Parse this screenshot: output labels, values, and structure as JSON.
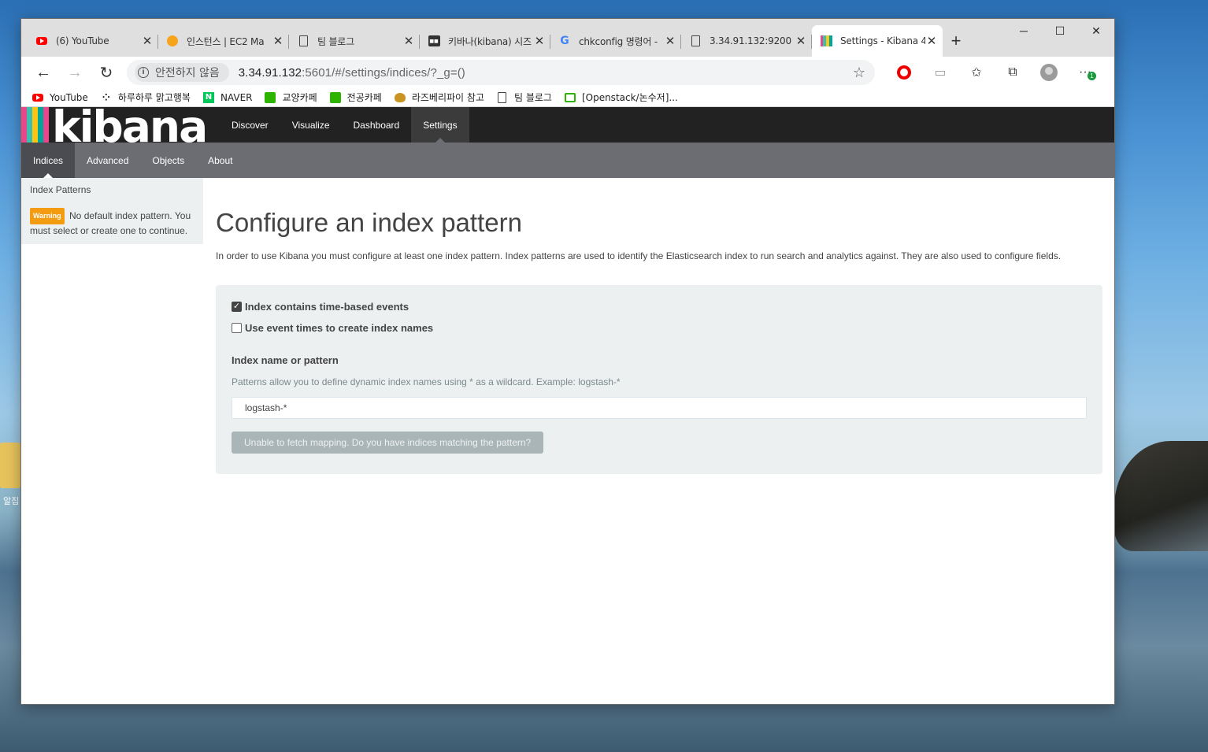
{
  "desktop": {
    "icon_label": "알집"
  },
  "browser": {
    "tabs": [
      {
        "title": "(6) YouTube",
        "icon": "youtube-icon",
        "active": false
      },
      {
        "title": "인스턴스 | EC2 Ma",
        "icon": "aws-icon",
        "active": false
      },
      {
        "title": "팀 블로그",
        "icon": "document-icon",
        "active": false
      },
      {
        "title": "키바나(kibana) 시즈",
        "icon": "blog-dark-icon",
        "active": false
      },
      {
        "title": "chkconfig 명령어 -",
        "icon": "google-icon",
        "active": false
      },
      {
        "title": "3.34.91.132:9200",
        "icon": "document-icon",
        "active": false
      },
      {
        "title": "Settings - Kibana 4",
        "icon": "kibana-icon",
        "active": true
      }
    ],
    "security_label": "안전하지 않음",
    "url_host": "3.34.91.132",
    "url_rest": ":5601/#/settings/indices/?_g=()",
    "extension_badge": "1",
    "bookmarks": [
      {
        "label": "YouTube",
        "icon": "youtube-icon"
      },
      {
        "label": "하루하루 맑고행복",
        "icon": "dots-icon"
      },
      {
        "label": "NAVER",
        "icon": "naver-icon"
      },
      {
        "label": "교양카페",
        "icon": "cafe-icon"
      },
      {
        "label": "전공카페",
        "icon": "cafe-icon"
      },
      {
        "label": "라즈베리파이 참고",
        "icon": "raspberry-icon"
      },
      {
        "label": "팀 블로그",
        "icon": "document-icon"
      },
      {
        "label": "[Openstack/논수저]...",
        "icon": "blog-icon"
      }
    ]
  },
  "kibana": {
    "logo": "kibana",
    "logo_colors": [
      "#e8488b",
      "#3cbeb1",
      "#fec514",
      "#00a69b",
      "#e8488b"
    ],
    "nav": [
      "Discover",
      "Visualize",
      "Dashboard",
      "Settings"
    ],
    "active_nav": "Settings",
    "subnav": [
      "Indices",
      "Advanced",
      "Objects",
      "About"
    ],
    "active_subnav": "Indices",
    "sidebar": {
      "title": "Index Patterns",
      "warning_badge": "Warning",
      "warning_text": "No default index pattern. You must select or create one to continue."
    },
    "main": {
      "title": "Configure an index pattern",
      "intro": "In order to use Kibana you must configure at least one index pattern. Index patterns are used to identify the Elasticsearch index to run search and analytics against. They are also used to configure fields.",
      "checkbox_time_based": {
        "label": "Index contains time-based events",
        "checked": true
      },
      "checkbox_event_times": {
        "label": "Use event times to create index names",
        "checked": false
      },
      "field_label": "Index name or pattern",
      "help_text": "Patterns allow you to define dynamic index names using * as a wildcard. Example: logstash-*",
      "input_value": "logstash-*",
      "button_label": "Unable to fetch mapping. Do you have indices matching the pattern?"
    }
  }
}
